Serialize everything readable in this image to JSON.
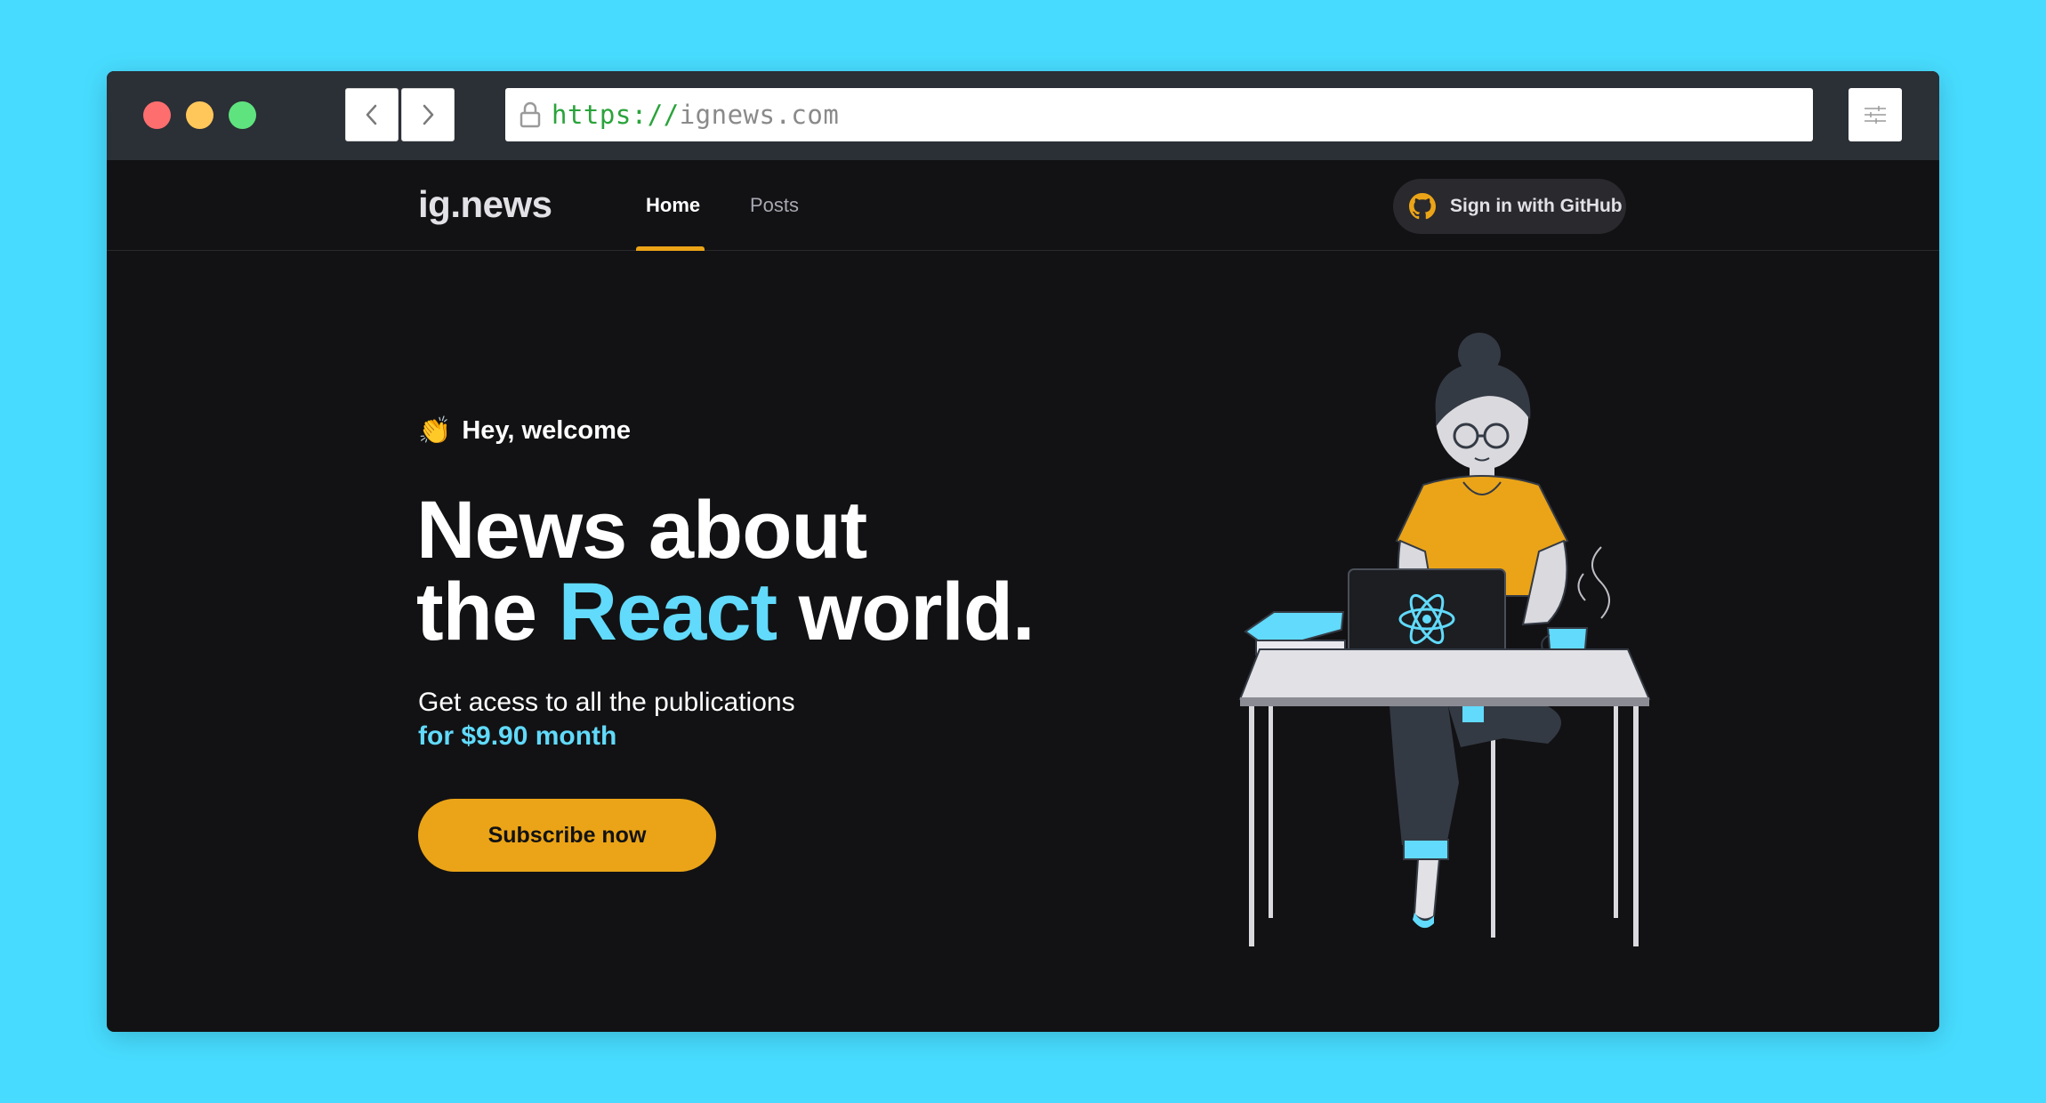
{
  "browser": {
    "url_protocol": "https://",
    "url_host": "ignews.com"
  },
  "header": {
    "logo": "ig.news",
    "nav": [
      {
        "label": "Home",
        "active": true
      },
      {
        "label": "Posts",
        "active": false
      }
    ],
    "signin_label": "Sign in with GitHub"
  },
  "hero": {
    "greeting_emoji": "👏",
    "greeting": "Hey, welcome",
    "title_line1": "News about",
    "title_line2_start": "the",
    "title_accent": "React",
    "title_line2_end": "world.",
    "subtitle": "Get acess to all the publications",
    "price": "for $9.90 month",
    "cta_label": "Subscribe now"
  },
  "colors": {
    "page_background": "#47dcff",
    "app_background": "#121214",
    "accent_yellow": "#eba417",
    "accent_cyan": "#61dafb"
  },
  "icons": {
    "back": "chevron-left-icon",
    "forward": "chevron-right-icon",
    "lock": "lock-icon",
    "settings": "sliders-icon",
    "github": "github-icon",
    "react": "react-icon"
  }
}
